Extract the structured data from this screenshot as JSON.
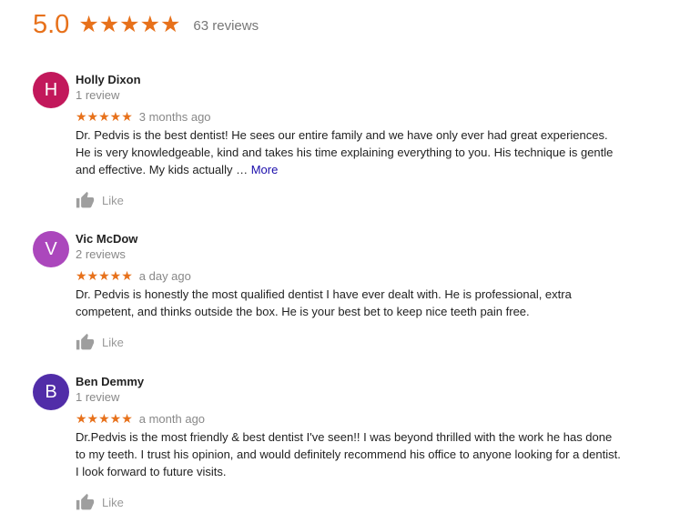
{
  "summary": {
    "score": "5.0",
    "stars": "★★★★★",
    "count": "63 reviews",
    "accent_color": "#e7711b"
  },
  "reviews": [
    {
      "initial": "H",
      "avatar_color": "#c2185b",
      "name": "Holly Dixon",
      "review_count": "1 review",
      "stars": "★★★★★",
      "rating": 5,
      "when": "3 months ago",
      "text": "Dr. Pedvis is the best dentist! He sees our entire family and we have only ever had great experiences. He is very knowledgeable, kind and takes his time explaining everything to you. His technique is gentle and effective. My kids actually … ",
      "more": "More",
      "like": "Like"
    },
    {
      "initial": "V",
      "avatar_color": "#ab47bc",
      "name": "Vic McDow",
      "review_count": "2 reviews",
      "stars": "★★★★★",
      "rating": 5,
      "when": "a day ago",
      "text": "Dr. Pedvis is honestly the most qualified dentist I have ever dealt with. He is professional, extra competent, and thinks outside the box. He is your best bet to keep nice teeth pain free.",
      "like": "Like"
    },
    {
      "initial": "B",
      "avatar_color": "#512da8",
      "name": "Ben Demmy",
      "review_count": "1 review",
      "stars": "★★★★★",
      "rating": 5,
      "when": "a month ago",
      "text": "Dr.Pedvis is the most friendly & best dentist I've seen!! I was beyond thrilled with the work he has done to my teeth. I trust his opinion, and would  definitely recommend his office to anyone looking for a dentist. I look forward to future visits.",
      "like": "Like"
    }
  ]
}
